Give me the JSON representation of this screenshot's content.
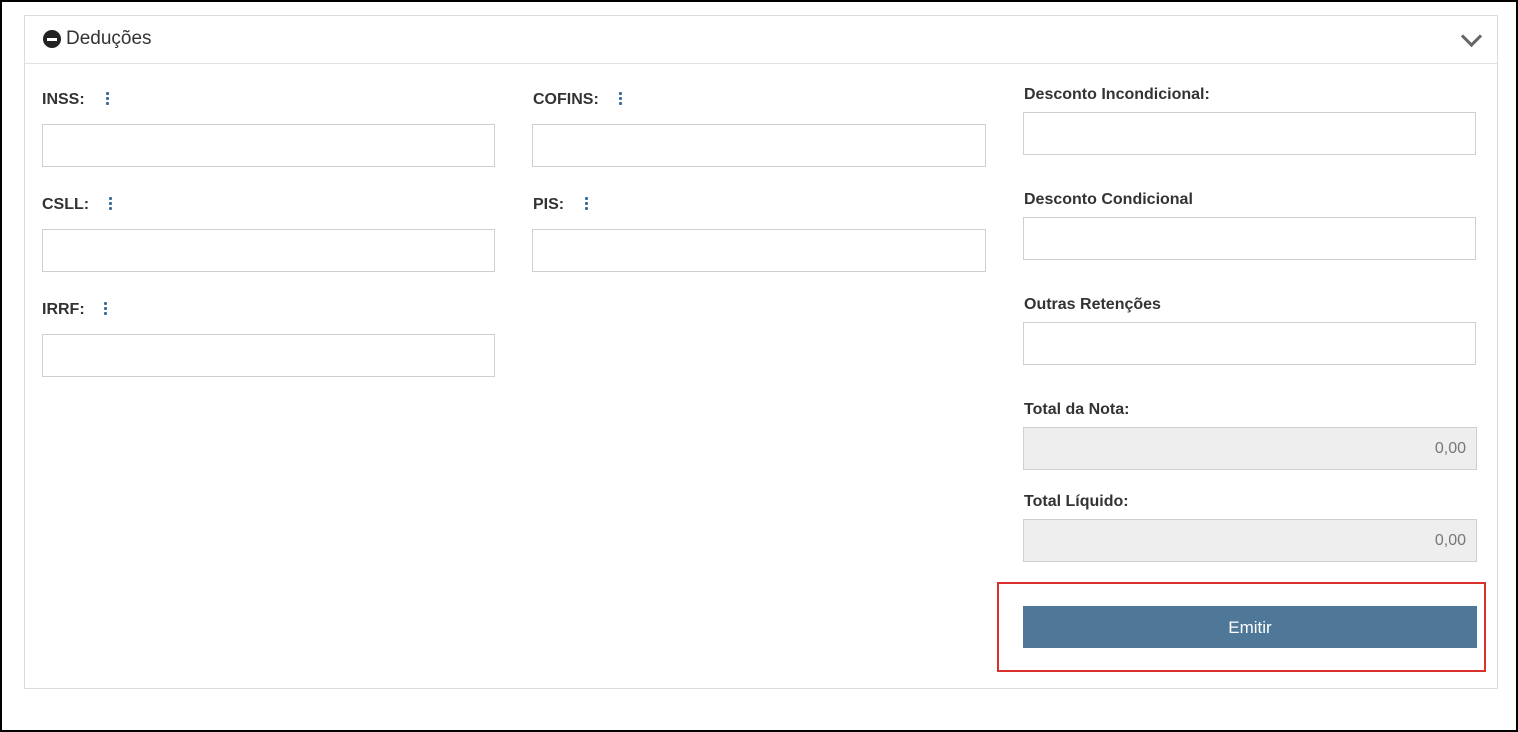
{
  "panel": {
    "title": "Deduções",
    "icon": "minus-circle-icon",
    "collapse_icon": "chevron-down-icon"
  },
  "fields": {
    "inss": {
      "label": "INSS:",
      "value": ""
    },
    "cofins": {
      "label": "COFINS:",
      "value": ""
    },
    "csll": {
      "label": "CSLL:",
      "value": ""
    },
    "pis": {
      "label": "PIS:",
      "value": ""
    },
    "irrf": {
      "label": "IRRF:",
      "value": ""
    },
    "desconto_incondicional": {
      "label": "Desconto Incondicional:",
      "value": ""
    },
    "desconto_condicional": {
      "label": "Desconto Condicional",
      "value": ""
    },
    "outras_retencoes": {
      "label": "Outras Retenções",
      "value": ""
    },
    "total_nota": {
      "label": "Total da Nota:",
      "value": "0,00"
    },
    "total_liquido": {
      "label": "Total Líquido:",
      "value": "0,00"
    }
  },
  "actions": {
    "emit_label": "Emitir"
  },
  "colors": {
    "accent": "#4e7798",
    "highlight": "#d9302c"
  }
}
